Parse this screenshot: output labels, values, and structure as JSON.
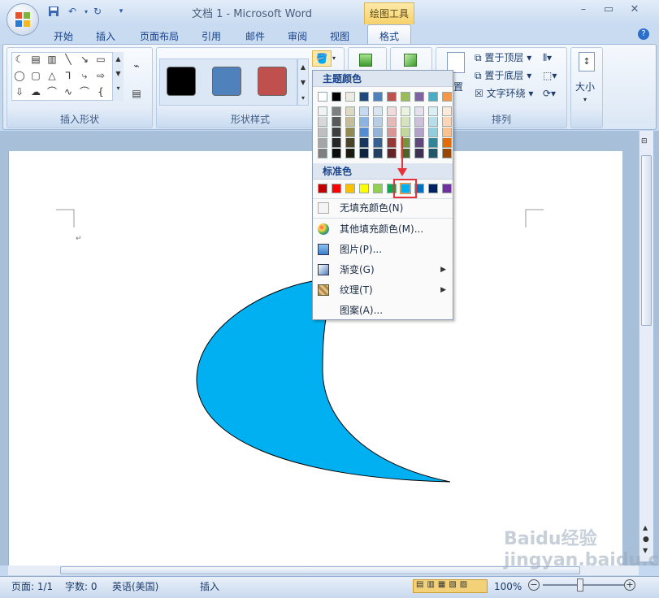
{
  "title_bar": {
    "doc_title": "文档 1 - Microsoft Word",
    "contextual_tool": "绘图工具"
  },
  "tabs": [
    "开始",
    "插入",
    "页面布局",
    "引用",
    "邮件",
    "审阅",
    "视图",
    "格式"
  ],
  "active_tab": "格式",
  "ribbon": {
    "insert_shapes_label": "插入形状",
    "shape_styles_label": "形状样式",
    "arrange_label": "排列",
    "arrange": {
      "bring_front": "置于顶层",
      "send_back": "置于底层",
      "text_wrap": "文字环绕",
      "position_partial": "置"
    },
    "size_label": "大小",
    "style_swatch_colors": [
      "#000000",
      "#4f81bd",
      "#c0504d"
    ]
  },
  "fill_menu": {
    "theme_colors_label": "主题颜色",
    "standard_colors_label": "标准色",
    "theme_top_row": [
      "#ffffff",
      "#000000",
      "#eeece1",
      "#1f497d",
      "#4f81bd",
      "#c0504d",
      "#9bbb59",
      "#8064a2",
      "#4bacc6",
      "#f79646"
    ],
    "theme_shades": [
      [
        "#f2f2f2",
        "#7f7f7f",
        "#ddd9c3",
        "#c6d9f0",
        "#dbe5f1",
        "#f2dcdb",
        "#ebf1dd",
        "#e5e0ec",
        "#dbeef3",
        "#fdeada"
      ],
      [
        "#d8d8d8",
        "#595959",
        "#c4bd97",
        "#8db3e2",
        "#b8cce4",
        "#e5b9b7",
        "#d7e3bc",
        "#ccc1d9",
        "#b7dde8",
        "#fbd5b5"
      ],
      [
        "#bfbfbf",
        "#3f3f3f",
        "#938953",
        "#548dd4",
        "#95b3d7",
        "#d99694",
        "#c3d69b",
        "#b2a2c7",
        "#92cddc",
        "#fac08f"
      ],
      [
        "#a5a5a5",
        "#262626",
        "#494429",
        "#17365d",
        "#366092",
        "#953734",
        "#76923c",
        "#5f497a",
        "#31859b",
        "#e36c09"
      ],
      [
        "#7f7f7f",
        "#0c0c0c",
        "#1d1b10",
        "#0f243e",
        "#244061",
        "#632423",
        "#4f6128",
        "#3f3151",
        "#205867",
        "#974806"
      ]
    ],
    "standard_colors": [
      "#c00000",
      "#ff0000",
      "#ffc000",
      "#ffff00",
      "#92d050",
      "#00b050",
      "#00b0f0",
      "#0070c0",
      "#002060",
      "#7030a0"
    ],
    "highlighted_standard_index": 6,
    "no_fill_label": "无填充颜色(N)",
    "more_colors_label": "其他填充颜色(M)...",
    "picture_label": "图片(P)...",
    "gradient_label": "渐变(G)",
    "texture_label": "纹理(T)",
    "pattern_label": "图案(A)..."
  },
  "shape": {
    "fill": "#00b0f0",
    "name": "moon-shape"
  },
  "status": {
    "page": "页面: 1/1",
    "words": "字数: 0",
    "language": "英语(美国)",
    "mode": "插入",
    "zoom": "100%"
  },
  "watermark": "Baidu经验 jingyan.baidu.com"
}
